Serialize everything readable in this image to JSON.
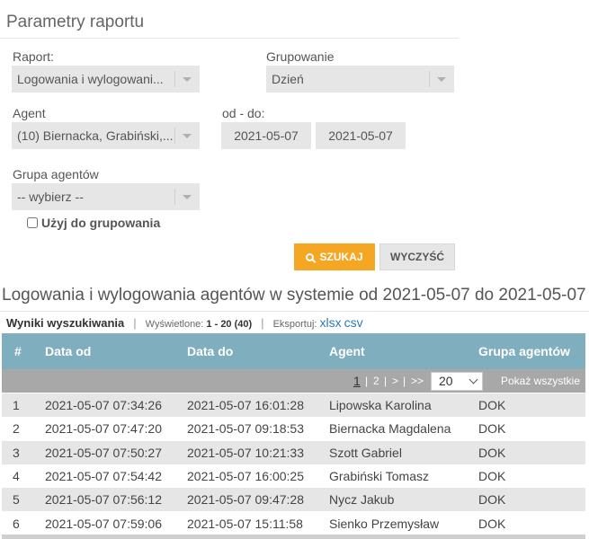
{
  "params": {
    "title": "Parametry raportu",
    "report_label": "Raport:",
    "report_value": "Logowania i wylogowani...",
    "grouping_label": "Grupowanie",
    "grouping_value": "Dzień",
    "agent_label": "Agent",
    "agent_value": "(10) Biernacka, Grabiński,...",
    "date_range_label": "od - do:",
    "date_from": "2021-05-07",
    "date_to": "2021-05-07",
    "agent_group_label": "Grupa agentów",
    "agent_group_value": "-- wybierz --",
    "use_grouping_label": "Użyj do grupowania",
    "search_button": "SZUKAJ",
    "clear_button": "WYCZYŚĆ"
  },
  "report": {
    "title": "Logowania i wylogowania agentów w systemie od 2021-05-07 do 2021-05-07",
    "results_label": "Wyniki wyszukiwania",
    "displayed_label": "Wyświetlone:",
    "displayed_value": "1 - 20 (40)",
    "export_label": "Eksportuj:",
    "export_xlsx": "xlsx",
    "export_csv": "csv"
  },
  "table": {
    "columns": [
      "#",
      "Data od",
      "Data do",
      "Agent",
      "Grupa agentów"
    ],
    "pager": {
      "pages": [
        "1",
        "2",
        ">",
        ">>"
      ],
      "per_page": "20",
      "show_all": "Pokaż wszystkie"
    },
    "rows": [
      [
        "1",
        "2021-05-07 07:34:26",
        "2021-05-07 16:01:28",
        "Lipowska Karolina",
        "DOK"
      ],
      [
        "2",
        "2021-05-07 07:47:20",
        "2021-05-07 09:18:53",
        "Biernacka Magdalena",
        "DOK"
      ],
      [
        "3",
        "2021-05-07 07:50:27",
        "2021-05-07 10:21:33",
        "Szott Gabriel",
        "DOK"
      ],
      [
        "4",
        "2021-05-07 07:54:42",
        "2021-05-07 16:00:25",
        "Grabiński Tomasz",
        "DOK"
      ],
      [
        "5",
        "2021-05-07 07:56:12",
        "2021-05-07 09:47:28",
        "Nycz Jakub",
        "DOK"
      ],
      [
        "6",
        "2021-05-07 07:59:06",
        "2021-05-07 15:11:58",
        "Sienko Przemysław",
        "DOK"
      ]
    ]
  },
  "colors": {
    "accent_button": "#f5a623",
    "table_header": "#7faebf",
    "pager_bar": "#a8a8a8",
    "link": "#2a7ab8"
  }
}
